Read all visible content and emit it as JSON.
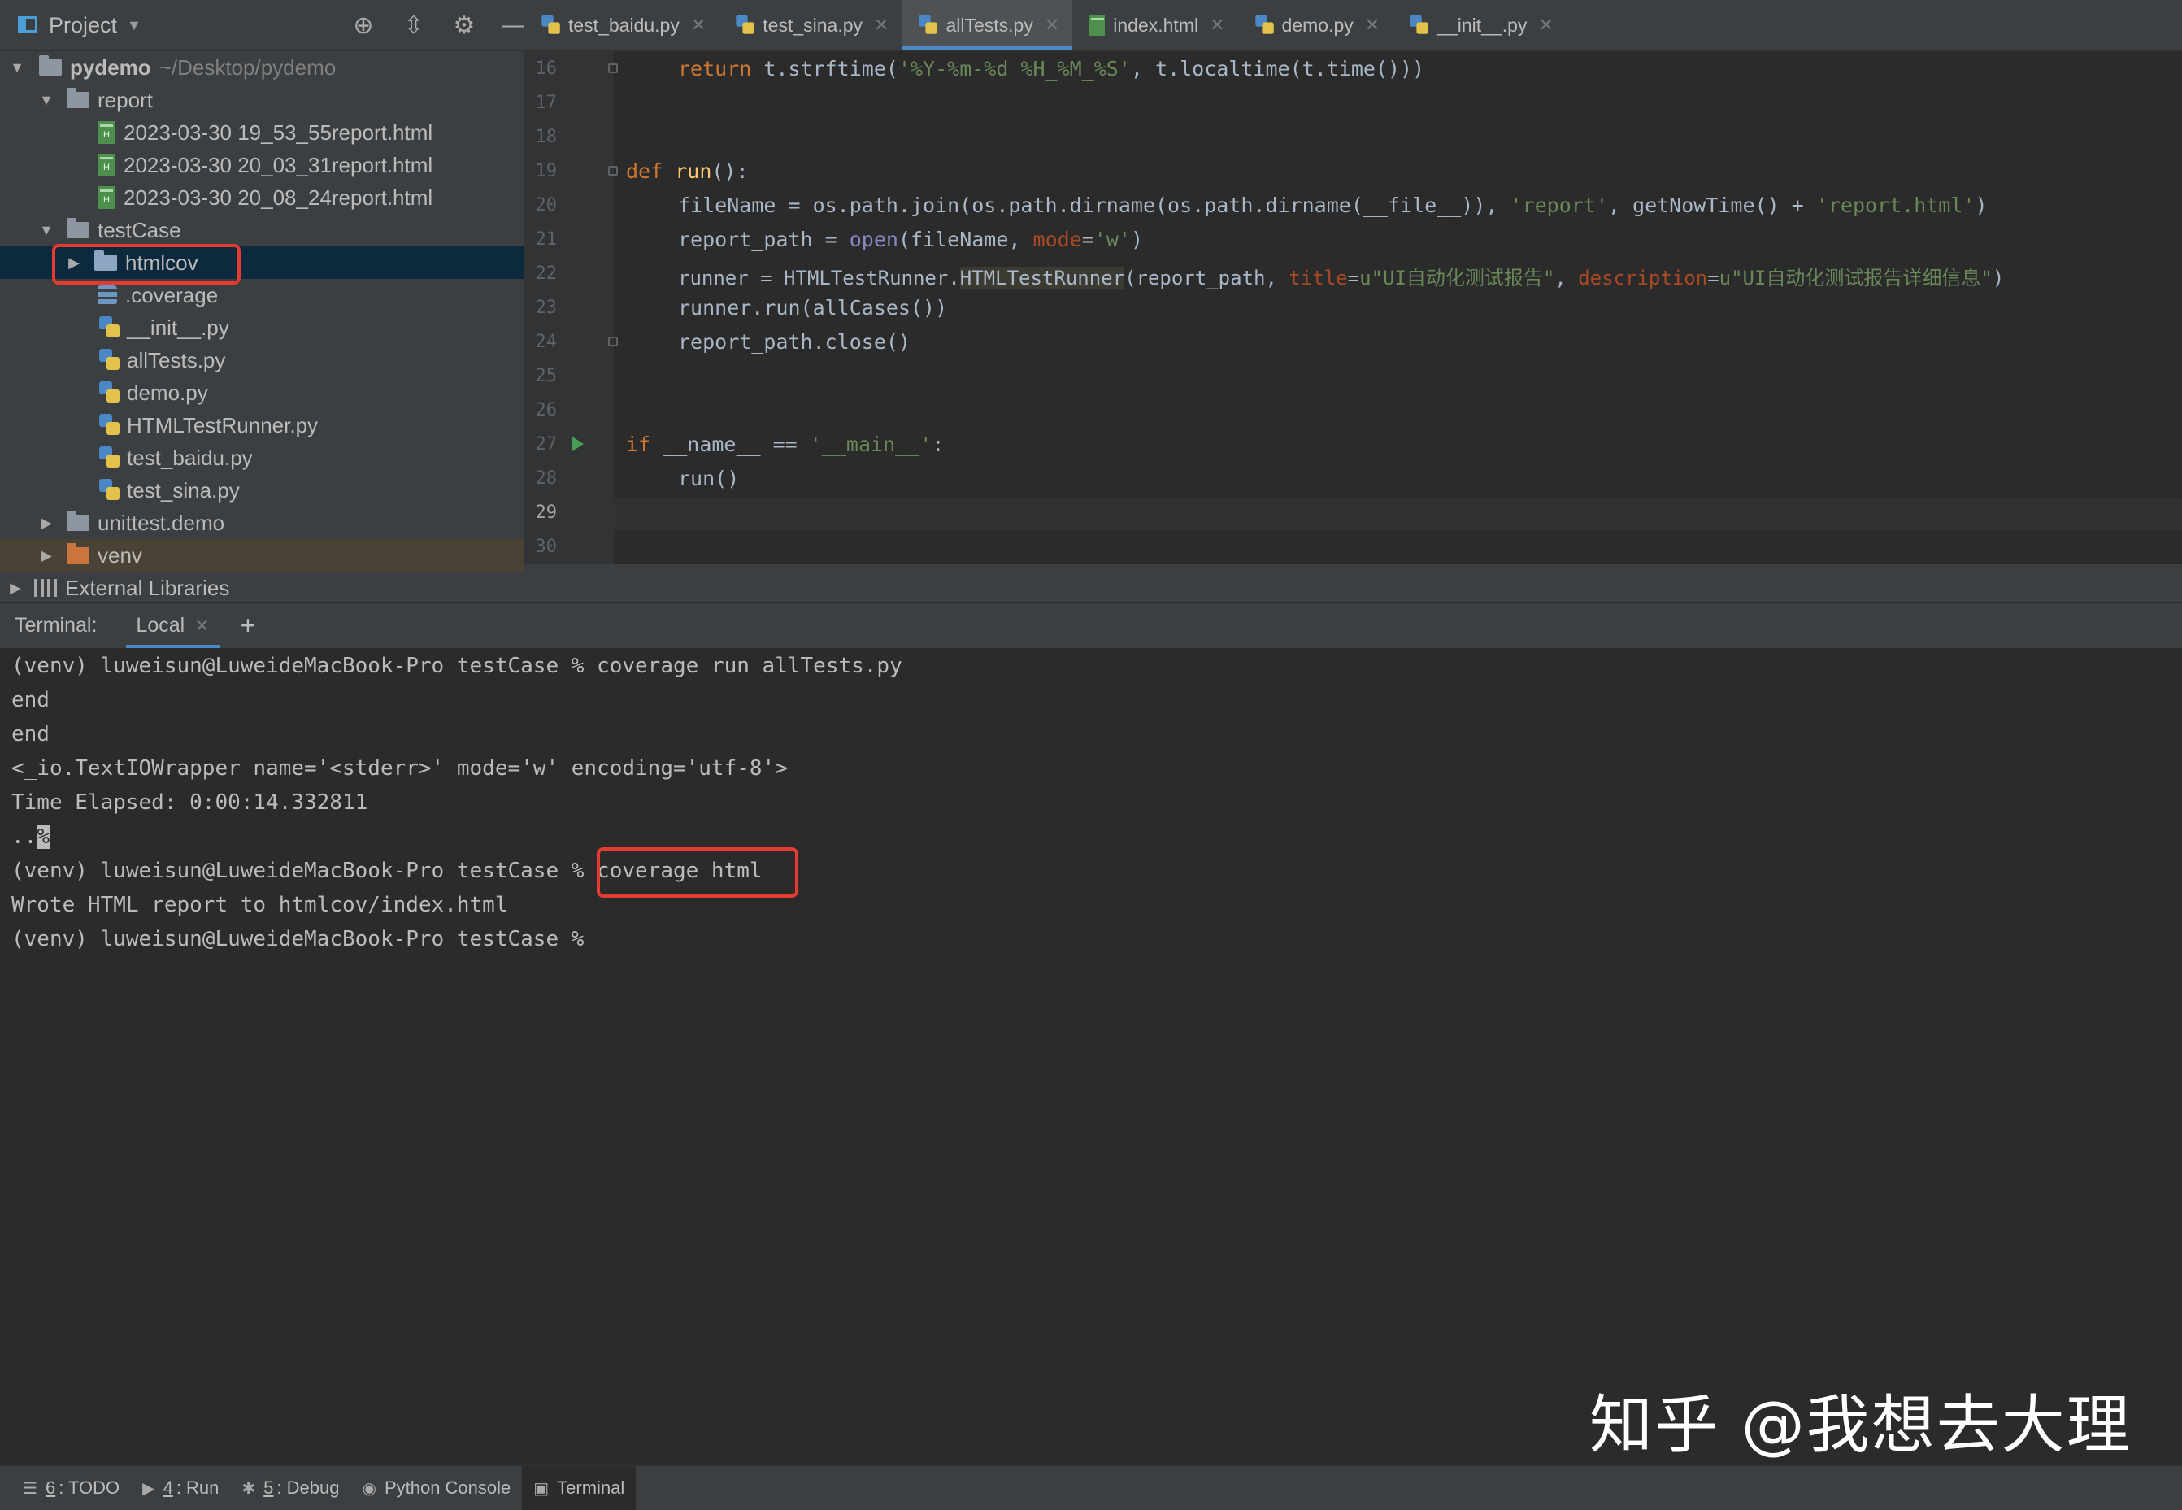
{
  "project_panel": {
    "title": "Project",
    "tool_icons": [
      "crosshair-icon",
      "collapse-icon",
      "gear-icon",
      "minimize-icon"
    ],
    "tree": [
      {
        "label": "pydemo",
        "path": "~/Desktop/pydemo",
        "type": "folder",
        "expanded": true
      },
      {
        "label": "report",
        "type": "folder",
        "expanded": true
      },
      {
        "label": "2023-03-30 19_53_55report.html",
        "type": "html"
      },
      {
        "label": "2023-03-30 20_03_31report.html",
        "type": "html"
      },
      {
        "label": "2023-03-30 20_08_24report.html",
        "type": "html"
      },
      {
        "label": "testCase",
        "type": "folder",
        "expanded": true
      },
      {
        "label": "htmlcov",
        "type": "folder",
        "expanded": false,
        "selected": true
      },
      {
        "label": ".coverage",
        "type": "db"
      },
      {
        "label": "__init__.py",
        "type": "py"
      },
      {
        "label": "allTests.py",
        "type": "py"
      },
      {
        "label": "demo.py",
        "type": "py"
      },
      {
        "label": "HTMLTestRunner.py",
        "type": "py"
      },
      {
        "label": "test_baidu.py",
        "type": "py"
      },
      {
        "label": "test_sina.py",
        "type": "py"
      },
      {
        "label": "unittest.demo",
        "type": "folder",
        "expanded": false
      },
      {
        "label": "venv",
        "type": "folder",
        "expanded": false
      },
      {
        "label": "External Libraries",
        "type": "library",
        "expanded": false
      }
    ]
  },
  "editor_tabs": [
    {
      "label": "test_baidu.py",
      "type": "py",
      "active": false
    },
    {
      "label": "test_sina.py",
      "type": "py",
      "active": false
    },
    {
      "label": "allTests.py",
      "type": "py",
      "active": true
    },
    {
      "label": "index.html",
      "type": "html",
      "active": false
    },
    {
      "label": "demo.py",
      "type": "py",
      "active": false
    },
    {
      "label": "__init__.py",
      "type": "py",
      "active": false
    }
  ],
  "editor": {
    "line_numbers": [
      "16",
      "17",
      "18",
      "19",
      "20",
      "21",
      "22",
      "23",
      "24",
      "25",
      "26",
      "27",
      "28",
      "29",
      "30"
    ],
    "code": {
      "l16": {
        "kw": "return",
        "rest": " t.strftime(",
        "str": "'%Y-%m-%d %H_%M_%S'",
        "tail": ", t.localtime(t.time()))"
      },
      "l19": {
        "kw": "def",
        "fn": "run",
        "tail": "():"
      },
      "l20": {
        "a": "fileName = os.path.join(os.path.dirname(os.path.dirname(__file__)), ",
        "s1": "'report'",
        "b": ", getNowTime() + ",
        "s2": "'report.html'",
        "c": ")"
      },
      "l21": {
        "a": "report_path = ",
        "bi": "open",
        "b": "(fileName, ",
        "p": "mode",
        "c": "=",
        "s": "'w'",
        "d": ")"
      },
      "l22": {
        "a": "runner = HTMLTestRunner.",
        "hl": "HTMLTestRunner",
        "b": "(report_path, ",
        "p1": "title",
        "c": "=",
        "s1": "u\"UI自动化测试报告\"",
        "d": ", ",
        "p2": "description",
        "e": "=",
        "s2": "u\"UI自动化测试报告详细信息\"",
        "f": ")"
      },
      "l23": "runner.run(allCases())",
      "l24": "report_path.close()",
      "l27": {
        "kw": "if",
        "a": " __name__ == ",
        "s": "'__main__'",
        "b": ":"
      },
      "l28": "run()"
    }
  },
  "terminal": {
    "header_label": "Terminal:",
    "tab_label": "Local",
    "lines": [
      "(venv) luweisun@LuweideMacBook-Pro testCase % coverage run allTests.py",
      "end",
      "end",
      "<_io.TextIOWrapper name='<stderr>' mode='w' encoding='utf-8'>",
      "Time Elapsed: 0:00:14.332811",
      "..",
      "(venv) luweisun@LuweideMacBook-Pro testCase % coverage html",
      "Wrote HTML report to htmlcov/index.html",
      "(venv) luweisun@LuweideMacBook-Pro testCase %"
    ],
    "cursor_char": "%"
  },
  "watermark": "知乎 @我想去大理",
  "bottom_bar": [
    {
      "num": "6",
      "label": ": TODO",
      "icon": "list-icon",
      "active": false
    },
    {
      "num": "4",
      "label": ": Run",
      "icon": "run-icon",
      "active": false
    },
    {
      "num": "5",
      "label": ": Debug",
      "icon": "bug-icon",
      "active": false
    },
    {
      "num": "",
      "label": "Python Console",
      "icon": "python-icon",
      "active": false
    },
    {
      "num": "",
      "label": "Terminal",
      "icon": "terminal-icon",
      "active": true
    }
  ],
  "colors": {
    "accent": "#4a88c7",
    "highlight_box": "#e53a2f",
    "keyword": "#cc7832",
    "string": "#6a8759"
  }
}
